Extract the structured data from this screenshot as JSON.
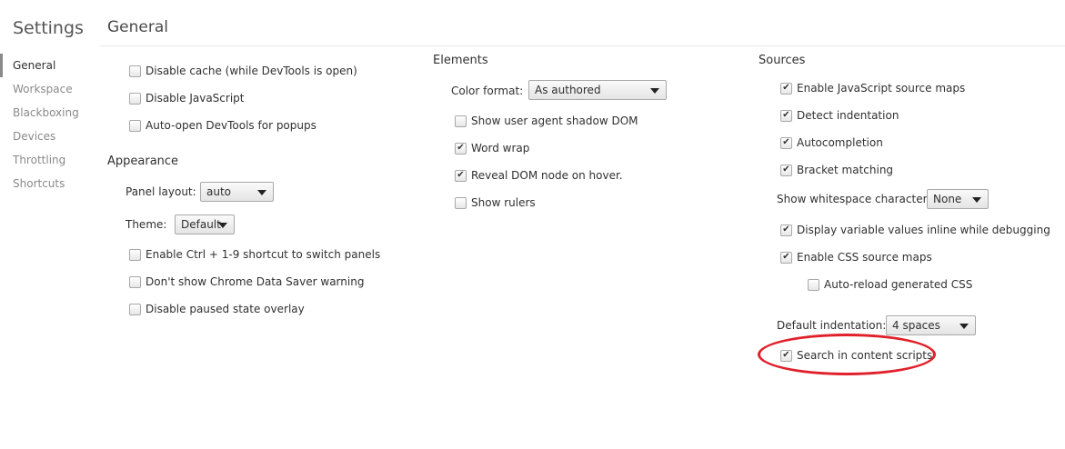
{
  "sidebar": {
    "title": "Settings",
    "items": [
      {
        "label": "General"
      },
      {
        "label": "Workspace"
      },
      {
        "label": "Blackboxing"
      },
      {
        "label": "Devices"
      },
      {
        "label": "Throttling"
      },
      {
        "label": "Shortcuts"
      }
    ]
  },
  "page": {
    "title": "General"
  },
  "general": {
    "items": [
      {
        "label": "Disable cache (while DevTools is open)",
        "checked": false
      },
      {
        "label": "Disable JavaScript",
        "checked": false
      },
      {
        "label": "Auto-open DevTools for popups",
        "checked": false
      }
    ]
  },
  "appearance": {
    "title": "Appearance",
    "panel_layout_label": "Panel layout:",
    "panel_layout_value": "auto",
    "theme_label": "Theme:",
    "theme_value": "Default",
    "items": [
      {
        "label": "Enable Ctrl + 1-9 shortcut to switch panels",
        "checked": false
      },
      {
        "label": "Don't show Chrome Data Saver warning",
        "checked": false
      },
      {
        "label": "Disable paused state overlay",
        "checked": false
      }
    ]
  },
  "elements": {
    "title": "Elements",
    "color_format_label": "Color format:",
    "color_format_value": "As authored",
    "items": [
      {
        "label": "Show user agent shadow DOM",
        "checked": false
      },
      {
        "label": "Word wrap",
        "checked": true
      },
      {
        "label": "Reveal DOM node on hover.",
        "checked": true
      },
      {
        "label": "Show rulers",
        "checked": false
      }
    ]
  },
  "sources": {
    "title": "Sources",
    "items": [
      {
        "label": "Enable JavaScript source maps",
        "checked": true
      },
      {
        "label": "Detect indentation",
        "checked": true
      },
      {
        "label": "Autocompletion",
        "checked": true
      },
      {
        "label": "Bracket matching",
        "checked": true
      }
    ],
    "whitespace_label": "Show whitespace characters:",
    "whitespace_value": "None",
    "items2": [
      {
        "label": "Display variable values inline while debugging",
        "checked": true
      },
      {
        "label": "Enable CSS source maps",
        "checked": true
      }
    ],
    "auto_reload": {
      "label": "Auto-reload generated CSS",
      "checked": false
    },
    "default_indent_label": "Default indentation:",
    "default_indent_value": "4 spaces",
    "search_content": {
      "label": "Search in content scripts",
      "checked": true
    }
  },
  "colors": {
    "highlight": "#e0202a"
  }
}
